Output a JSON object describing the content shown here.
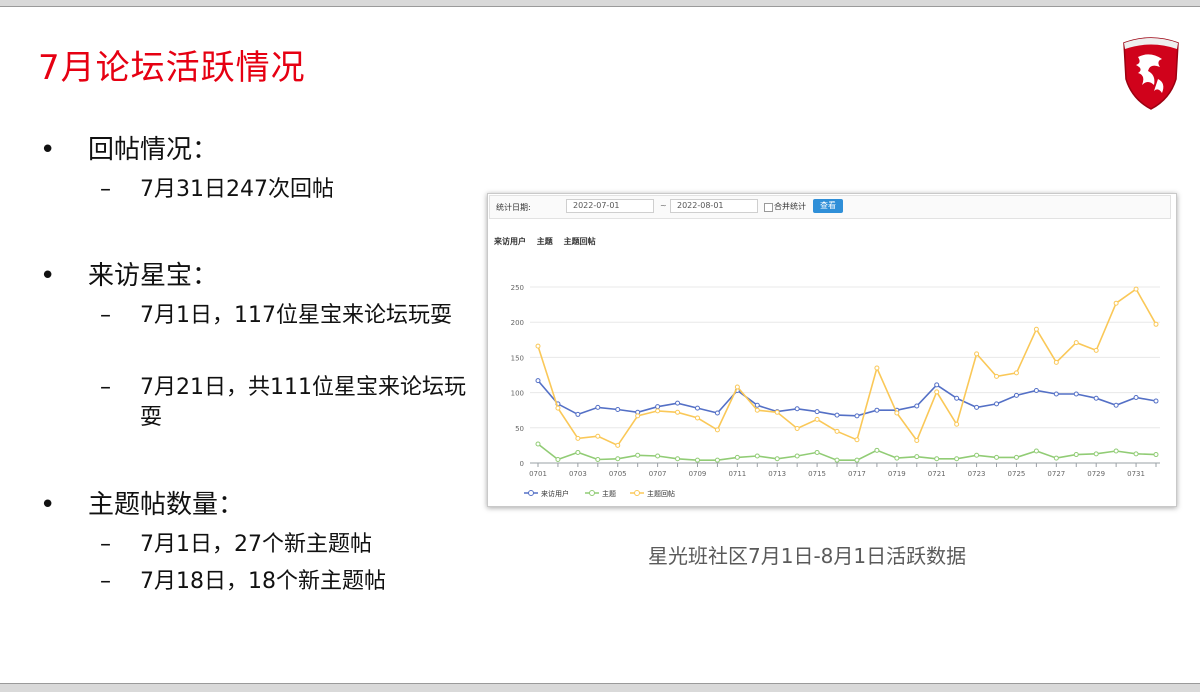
{
  "slide": {
    "title": "7月论坛活跃情况",
    "caption": "星光班社区7月1日-8月1日活跃数据"
  },
  "bullets": [
    {
      "label": "回帖情况：",
      "subs": [
        "7月31日247次回帖"
      ]
    },
    {
      "label": "来访星宝：",
      "subs": [
        "7月1日，117位星宝来论坛玩耍",
        "7月21日，共111位星宝来论坛玩耍"
      ]
    },
    {
      "label": "主题帖数量：",
      "subs": [
        "7月1日，27个新主题帖",
        "7月18日，18个新主题帖"
      ]
    }
  ],
  "filter": {
    "date_label": "统计日期:",
    "start_date": "2022-07-01",
    "separator": "~",
    "end_date": "2022-08-01",
    "merge_label": "合并统计",
    "view_button": "查看"
  },
  "tabs": [
    "来访用户",
    "主题",
    "主题回帖"
  ],
  "chart_data": {
    "type": "line",
    "x": [
      "0701",
      "0702",
      "0703",
      "0704",
      "0705",
      "0706",
      "0707",
      "0708",
      "0709",
      "0710",
      "0711",
      "0712",
      "0713",
      "0714",
      "0715",
      "0716",
      "0717",
      "0718",
      "0719",
      "0720",
      "0721",
      "0722",
      "0723",
      "0724",
      "0725",
      "0726",
      "0727",
      "0728",
      "0729",
      "0730",
      "0731",
      "0801"
    ],
    "x_tick_labels": [
      "0701",
      "0703",
      "0705",
      "0707",
      "0709",
      "0711",
      "0713",
      "0715",
      "0717",
      "0719",
      "0721",
      "0723",
      "0725",
      "0727",
      "0729",
      "0731"
    ],
    "ylim": [
      0,
      250
    ],
    "y_ticks": [
      0,
      50,
      100,
      150,
      200,
      250
    ],
    "grid": true,
    "legend_position": "bottom-left",
    "series": [
      {
        "name": "来访用户",
        "color": "#5470c6",
        "values": [
          117,
          84,
          69,
          79,
          76,
          72,
          80,
          85,
          78,
          71,
          103,
          82,
          73,
          77,
          73,
          68,
          67,
          75,
          75,
          81,
          111,
          92,
          79,
          84,
          96,
          103,
          98,
          98,
          92,
          82,
          93,
          88
        ]
      },
      {
        "name": "主题",
        "color": "#91cc75",
        "values": [
          27,
          5,
          15,
          5,
          6,
          11,
          10,
          6,
          4,
          4,
          8,
          10,
          6,
          10,
          15,
          4,
          4,
          18,
          7,
          9,
          6,
          6,
          11,
          8,
          8,
          17,
          7,
          12,
          13,
          17,
          13,
          12
        ]
      },
      {
        "name": "主题回帖",
        "color": "#fac858",
        "values": [
          166,
          78,
          35,
          38,
          25,
          67,
          74,
          72,
          64,
          47,
          108,
          75,
          72,
          49,
          62,
          45,
          33,
          135,
          71,
          32,
          101,
          55,
          155,
          123,
          128,
          190,
          143,
          171,
          160,
          227,
          247,
          197
        ]
      }
    ]
  },
  "colors": {
    "title": "#e60012",
    "logo": "#d0021b",
    "view_button": "#2f8fd8"
  },
  "icons": {
    "logo": "msi-dragon-shield-logo"
  }
}
